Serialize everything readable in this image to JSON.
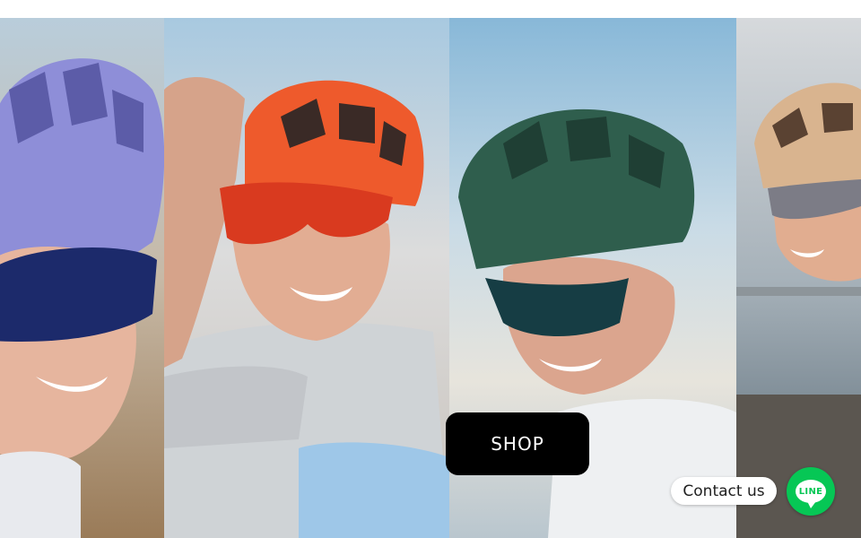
{
  "hero": {
    "shop_label": "SHOP",
    "panels": [
      {
        "name": "rider-lavender-helmet",
        "helmet_color": "#8e8ed8",
        "lens_color": "#1c2a6b"
      },
      {
        "name": "rider-orange-helmet",
        "helmet_color": "#ee5a2c",
        "lens_color": "#d93a1f"
      },
      {
        "name": "rider-green-helmet",
        "helmet_color": "#2f5e4d",
        "lens_color": "#163d44"
      },
      {
        "name": "rider-beige-helmet",
        "helmet_color": "#d9b48f",
        "lens_color": "#7c7c86"
      }
    ]
  },
  "contact": {
    "label": "Contact us",
    "line_label": "LINE",
    "line_color": "#06c755"
  },
  "colors": {
    "shop_button_bg": "#000000",
    "shop_button_text": "#ffffff"
  }
}
